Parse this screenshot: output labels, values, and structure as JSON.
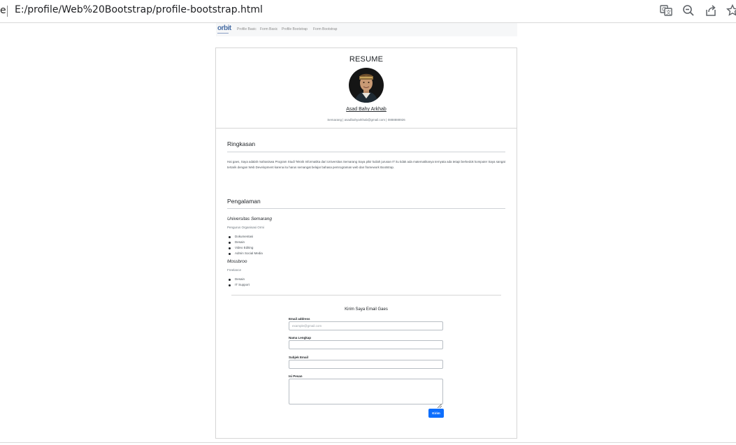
{
  "browser": {
    "tab_fragment": "e",
    "url": "E:/profile/Web%20Bootstrap/profile-bootstrap.html",
    "toolbar_icons": [
      "translate-icon",
      "zoom-out-icon",
      "share-icon",
      "bookmark-star-icon"
    ]
  },
  "navbar": {
    "brand": "orbit",
    "links": [
      "Profile Basic",
      "Form Basic",
      "Profile Bootstrap",
      "Form Bootstrap"
    ]
  },
  "header": {
    "title": "RESUME",
    "name": "Asad Bahy Arkhab",
    "contact": "Semarang | asadbahyarkhab@gmail.com | 0888888926"
  },
  "summary": {
    "heading": "Ringkasan",
    "text": "Hai gaes, Saya adalah mahasiswa Program Studi Teknik Informatika dari Universitas Semarang Saya pikir kuliah jurusan IT itu tidak ada matematikanya ternyata ada tetapi berkedok komputer Saya sangat tertarik dengan Web Development karena itu harus semangat belajar bahasa pemrograman web dan framework Bootstrap."
  },
  "experience": {
    "heading": "Pengalaman",
    "jobs": [
      {
        "org": "Universitas Semarang",
        "role": "Pengurus Organisasi Ormi",
        "items": [
          "Dokumentasi",
          "Desain",
          "Video Editing",
          "Admin Social Media"
        ]
      },
      {
        "org": "Mossbroo",
        "role": "Freelance",
        "items": [
          "Desain",
          "IT Support"
        ]
      }
    ]
  },
  "form": {
    "title": "Kirim Saya Email Gaes",
    "email_label": "Email address",
    "email_placeholder": "example@gmail.com",
    "name_label": "Nama Lengkap",
    "subject_label": "Subjek Email",
    "message_label": "Isi Pesan",
    "submit_label": "Kirim"
  }
}
